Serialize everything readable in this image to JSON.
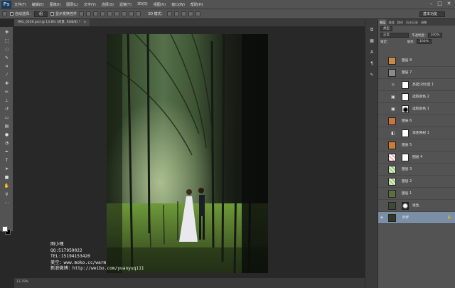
{
  "app": {
    "logo": "Ps"
  },
  "menu": [
    "文件(F)",
    "编辑(E)",
    "图像(I)",
    "图层(L)",
    "文字(Y)",
    "选择(S)",
    "滤镜(T)",
    "3D(D)",
    "视图(V)",
    "窗口(W)",
    "帮助(H)"
  ],
  "window_controls": [
    "–",
    "□",
    "✕"
  ],
  "options": {
    "auto_select_label": "自动选择：",
    "auto_select_value": "组",
    "show_transform_label": "显示变换控件",
    "mode_3d_label": "3D 模式：",
    "workspace": "基本功能"
  },
  "document": {
    "tab_title": "IMG_0559.psd @ 13.8% (背景, RGB/8) *",
    "close_glyph": "×"
  },
  "watermark": {
    "lines": [
      "图小哩",
      "QQ:517959022",
      "TEL:15194153420",
      "美空：www.moko.cc/warm",
      "新浪微博：http://weibo.com/yuanyuqi11"
    ]
  },
  "status": {
    "zoom": "13.79%"
  },
  "panel": {
    "tabs": [
      "图层",
      "通道",
      "路径",
      "历史记录",
      "调整"
    ],
    "kind_label": "类型",
    "blend_mode": "正常",
    "opacity_label": "不透明度：",
    "opacity_value": "100%",
    "lock_label": "锁定：",
    "fill_label": "填充：",
    "fill_value": "100%",
    "layers": [
      {
        "name": "图层 8",
        "thumb": "#c78a4a",
        "kind": "pixel"
      },
      {
        "name": "图层 7",
        "thumb": "#8a8a8a",
        "kind": "pixel"
      },
      {
        "name": "亮度/对比度 1",
        "thumb": "",
        "kind": "adjust",
        "icon": "☼"
      },
      {
        "name": "选取颜色 2",
        "thumb": "",
        "kind": "adjust",
        "icon": "▣"
      },
      {
        "name": "选取颜色 1",
        "thumb": "",
        "kind": "adjust",
        "icon": "▣"
      },
      {
        "name": "图层 6",
        "thumb": "#c8763d",
        "kind": "pixel"
      },
      {
        "name": "渐变映射 1",
        "thumb": "",
        "kind": "adjust",
        "icon": "◧"
      },
      {
        "name": "图层 5",
        "thumb": "#d07b35",
        "kind": "pixel"
      },
      {
        "name": "图层 4",
        "thumb": "#e8a0a0",
        "kind": "pixel-mask"
      },
      {
        "name": "图层 3",
        "thumb": "#7ea26a",
        "kind": "pixel"
      },
      {
        "name": "图层 2",
        "thumb": "#7ea26a",
        "kind": "pixel"
      },
      {
        "name": "图层 1",
        "thumb": "#5b6f3f",
        "kind": "pixel"
      },
      {
        "name": "进色",
        "thumb": "#3f4a33",
        "kind": "pixel-mask"
      },
      {
        "name": "背景",
        "thumb": "#2f3a26",
        "kind": "background",
        "lock": "🔒"
      }
    ]
  },
  "colors": {
    "selected_layer": "#7a8fa6",
    "ui_dark": "#282828",
    "ui_mid": "#535353"
  }
}
